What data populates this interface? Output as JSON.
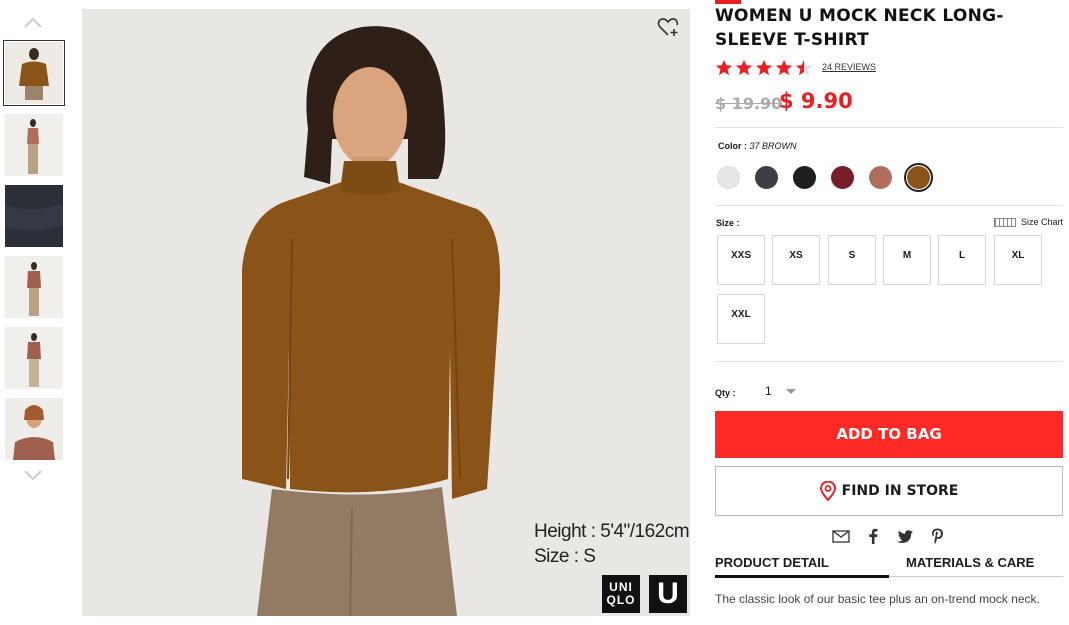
{
  "product": {
    "title": "WOMEN U MOCK NECK LONG-SLEEVE T-SHIRT",
    "rating": 4.5,
    "reviews_label": "24 REVIEWS",
    "price_original": "$ 19.90",
    "price_sale": "$ 9.90"
  },
  "color": {
    "label": "Color :",
    "selected": "37 BROWN",
    "swatches": [
      {
        "name": "white",
        "hex": "#e6e6e6"
      },
      {
        "name": "dark-gray",
        "hex": "#3c3f48"
      },
      {
        "name": "black",
        "hex": "#1f1f1f"
      },
      {
        "name": "wine",
        "hex": "#781d2a"
      },
      {
        "name": "pink-brown",
        "hex": "#b06f5d"
      },
      {
        "name": "brown",
        "hex": "#8a5418"
      }
    ]
  },
  "size": {
    "label": "Size :",
    "chart_label": "Size Chart",
    "options": [
      "XXS",
      "XS",
      "S",
      "M",
      "L",
      "XL",
      "XXL"
    ]
  },
  "qty": {
    "label": "Qty :",
    "value": "1"
  },
  "actions": {
    "add_to_bag": "ADD TO BAG",
    "find_in_store": "FIND IN STORE"
  },
  "tabs": {
    "detail": "PRODUCT DETAIL",
    "materials": "MATERIALS & CARE"
  },
  "description": "The classic look of our basic tee plus an on-trend mock neck.",
  "image": {
    "height_label": "Height : 5'4\"/162cm",
    "size_label": "Size : S",
    "logo_top": "UNI",
    "logo_bottom": "QLO",
    "logo_u": "U"
  },
  "colors": {
    "accent": "#ff2a25",
    "sale_price": "#ed1d24",
    "shirt": "#8a5418"
  }
}
